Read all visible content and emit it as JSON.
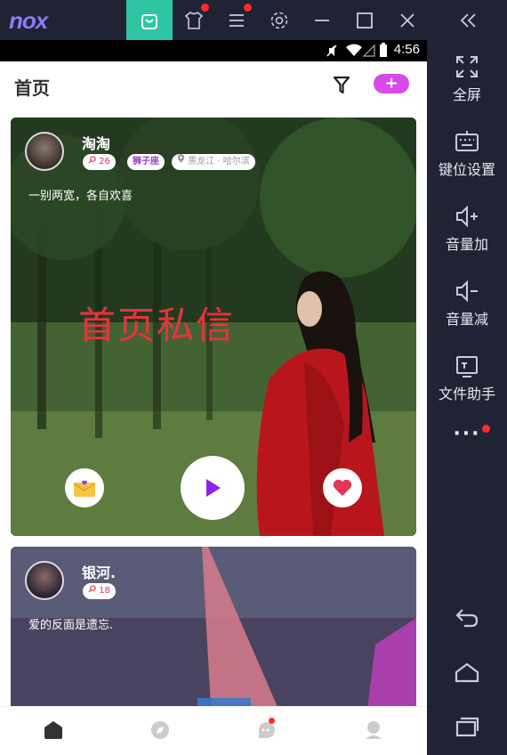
{
  "emulator": {
    "logo": "nox",
    "window_controls": [
      "minimize",
      "maximize",
      "close"
    ],
    "collapse_label": "«"
  },
  "status_bar": {
    "time": "4:56"
  },
  "header": {
    "title": "首页",
    "add_label": "+"
  },
  "cards": [
    {
      "name": "淘淘",
      "likes": "26",
      "zodiac": "狮子座",
      "location": "黑龙江 · 哈尔滨",
      "bio": "一别两宽，各自欢喜",
      "overlay": "首页私信"
    },
    {
      "name": "银河.",
      "likes": "18",
      "bio": "爱的反面是遗忘."
    }
  ],
  "sidebar": {
    "items": [
      {
        "label": "全屏",
        "icon": "fullscreen-icon"
      },
      {
        "label": "键位设置",
        "icon": "keyboard-icon"
      },
      {
        "label": "音量加",
        "icon": "volume-up-icon"
      },
      {
        "label": "音量减",
        "icon": "volume-down-icon"
      },
      {
        "label": "文件助手",
        "icon": "file-assistant-icon"
      }
    ],
    "more": "···"
  },
  "colors": {
    "accent_green": "#2ec6a2",
    "accent_purple": "#d84ae8",
    "heart_red": "#e8335a",
    "overlay_red": "#e8333a"
  }
}
